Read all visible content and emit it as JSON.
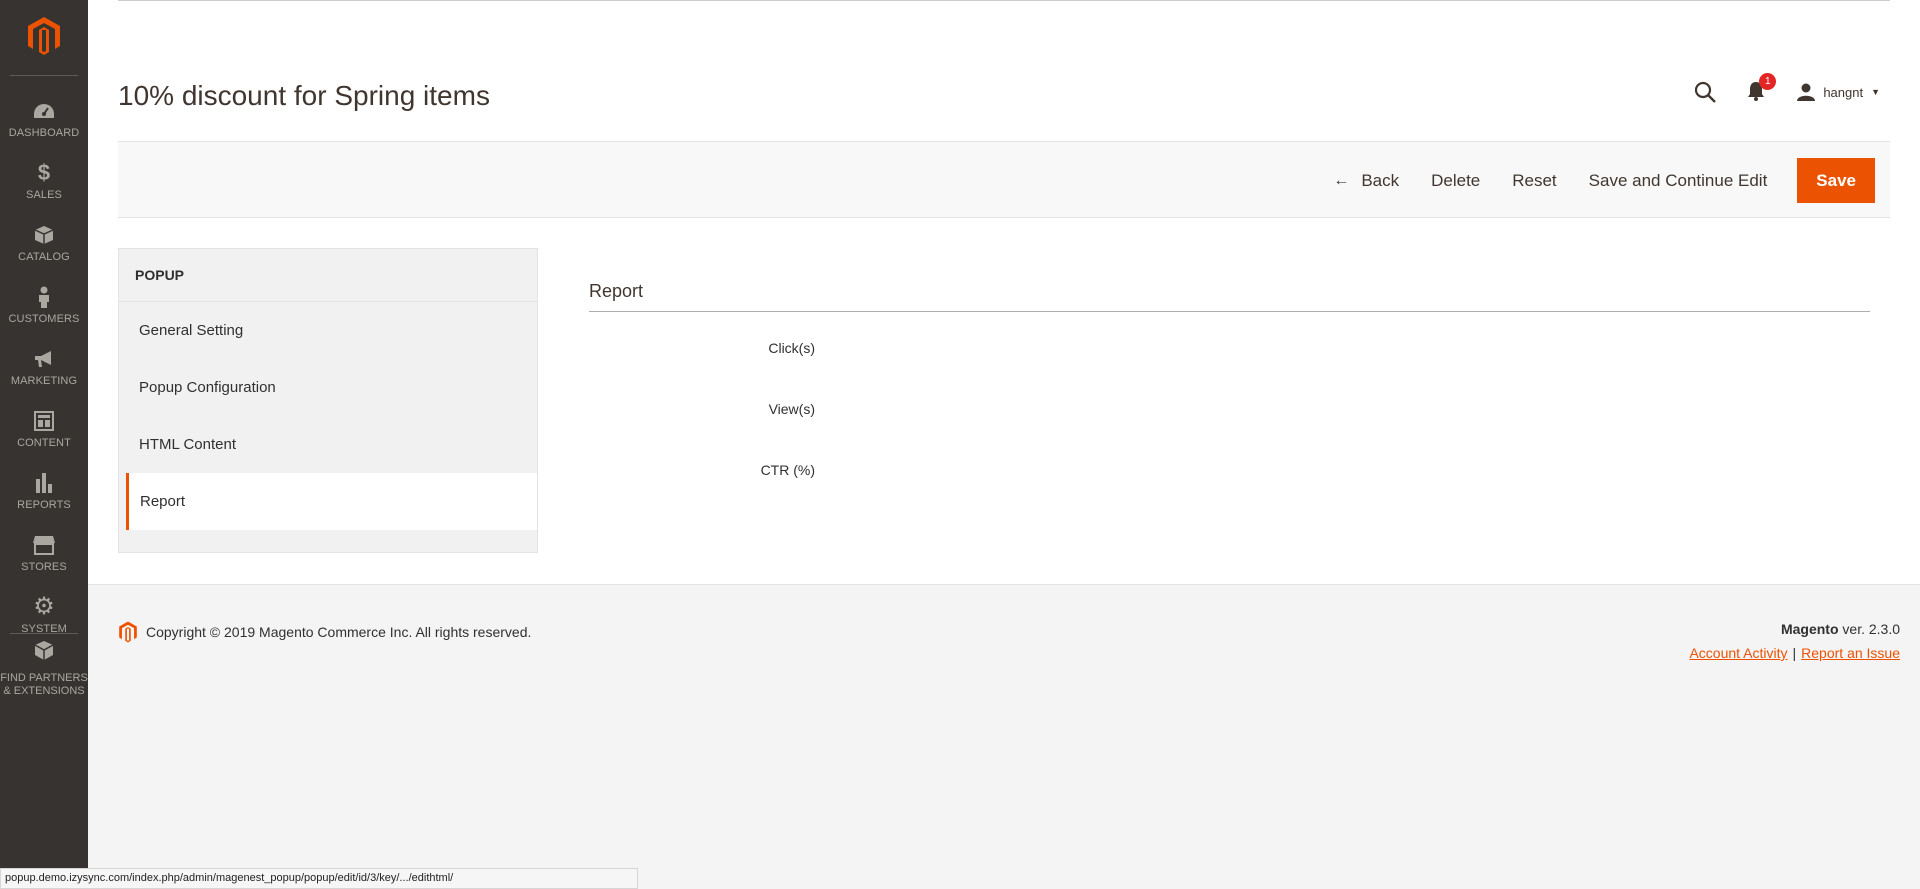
{
  "nav": {
    "items": [
      {
        "label": "DASHBOARD",
        "icon": "dashboard-icon"
      },
      {
        "label": "SALES",
        "icon": "dollar-icon"
      },
      {
        "label": "CATALOG",
        "icon": "box-icon"
      },
      {
        "label": "CUSTOMERS",
        "icon": "person-icon"
      },
      {
        "label": "MARKETING",
        "icon": "megaphone-icon"
      },
      {
        "label": "CONTENT",
        "icon": "layout-icon"
      },
      {
        "label": "REPORTS",
        "icon": "bar-chart-icon"
      },
      {
        "label": "STORES",
        "icon": "store-icon"
      },
      {
        "label": "SYSTEM",
        "icon": "gear-icon"
      }
    ],
    "partners_line1": "FIND PARTNERS",
    "partners_line2": "& EXTENSIONS"
  },
  "header": {
    "title": "10% discount for Spring items",
    "notification_count": "1",
    "username": "hangnt"
  },
  "actions": {
    "back": "Back",
    "delete": "Delete",
    "reset": "Reset",
    "save_continue": "Save and Continue Edit",
    "save": "Save"
  },
  "tabs": {
    "heading": "POPUP",
    "items": [
      "General Setting",
      "Popup Configuration",
      "HTML Content",
      "Report"
    ],
    "active": "Report"
  },
  "report": {
    "title": "Report",
    "fields": [
      "Click(s)",
      "View(s)",
      "CTR (%)"
    ]
  },
  "footer": {
    "copyright": "Copyright © 2019 Magento Commerce Inc. All rights reserved.",
    "brand": "Magento",
    "version": " ver. 2.3.0",
    "account_activity": "Account Activity",
    "separator": "|",
    "report_issue": "Report an Issue"
  },
  "statusbar": {
    "url": "popup.demo.izysync.com/index.php/admin/magenest_popup/popup/edit/id/3/key/.../edithtml/"
  },
  "colors": {
    "accent": "#eb5202",
    "nav_bg": "#373330",
    "badge": "#e22626"
  }
}
